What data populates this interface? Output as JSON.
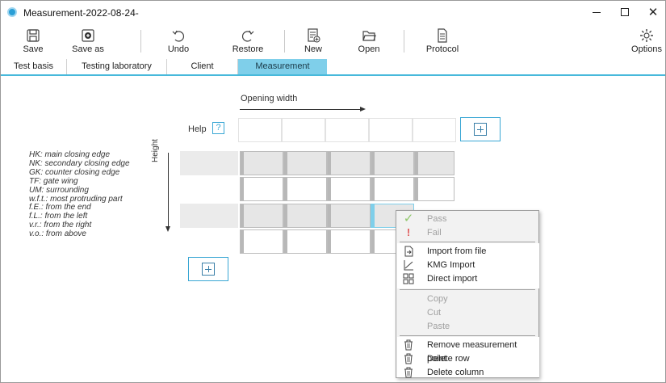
{
  "window": {
    "title": "Measurement-2022-08-24-",
    "min_glyph": "",
    "max_glyph": "",
    "close_glyph": "✕"
  },
  "toolbar": {
    "save": "Save",
    "save_as": "Save as",
    "undo": "Undo",
    "restore": "Restore",
    "new": "New",
    "open": "Open",
    "protocol": "Protocol",
    "options": "Options"
  },
  "tabs": [
    {
      "label": "Test basis"
    },
    {
      "label": "Testing laboratory"
    },
    {
      "label": "Client"
    },
    {
      "label": "Measurement",
      "active": true
    }
  ],
  "content": {
    "opening_width": "Opening width",
    "help": "Help",
    "help_glyph": "?",
    "height": "Height",
    "legend": [
      "HK: main closing edge",
      "NK: secondary closing edge",
      "GK: counter closing edge",
      "TF: gate wing",
      "UM: surrounding",
      "w.f.t.: most protruding part",
      "f.E.: from the end",
      "f.L.: from the left",
      "v.r.: from the right",
      "v.o.: from above"
    ]
  },
  "context_menu": {
    "pass": "Pass",
    "fail": "Fail",
    "import_from_file": "Import from file",
    "kmg_import": "KMG Import",
    "direct_import": "Direct import",
    "copy": "Copy",
    "cut": "Cut",
    "paste": "Paste",
    "remove_point": "Remove measurement point",
    "delete_row": "Delete row",
    "delete_column": "Delete column",
    "pass_glyph": "✓",
    "fail_glyph": "!"
  },
  "colors": {
    "accent": "#48b9db",
    "active_tab": "#7fcfea",
    "pass_green": "#8fc76a",
    "fail_red": "#e05a5a"
  }
}
